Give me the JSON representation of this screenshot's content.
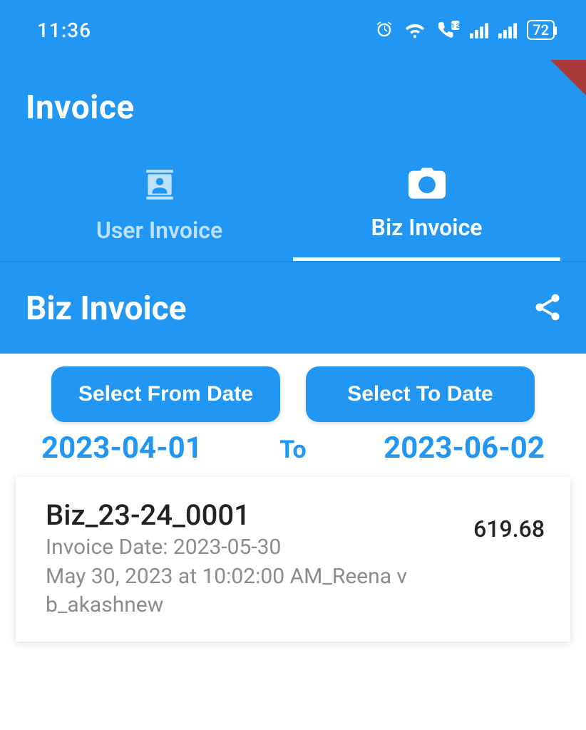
{
  "status_bar": {
    "time": "11:36",
    "battery": "72"
  },
  "header": {
    "title": "Invoice"
  },
  "tabs": {
    "user": {
      "label": "User Invoice"
    },
    "biz": {
      "label": "Biz Invoice"
    }
  },
  "section": {
    "title": "Biz Invoice"
  },
  "date_filter": {
    "from_button": "Select From Date",
    "to_button": "Select To Date",
    "from_value": "2023-04-01",
    "to_label": "To",
    "to_value": "2023-06-02"
  },
  "invoices": [
    {
      "id": "Biz_23-24_0001",
      "date_line": "Invoice Date: 2023-05-30",
      "detail_line": "May 30, 2023 at 10:02:00 AM_Reena v b_akashnew",
      "amount": "619.68"
    }
  ]
}
